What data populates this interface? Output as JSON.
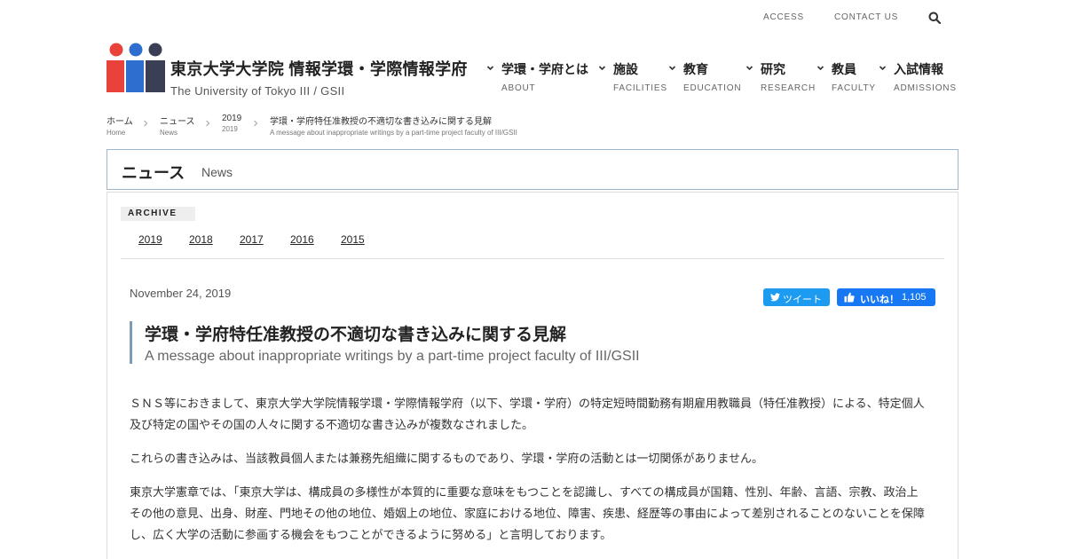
{
  "utility": {
    "access": "ACCESS",
    "contact": "CONTACT US"
  },
  "site": {
    "title_ja": "東京大学大学院 情報学環・学際情報学府",
    "title_en": "The University of Tokyo III / GSII",
    "logo_colors": [
      "#e8423b",
      "#2e6ecf",
      "#3a3f55"
    ]
  },
  "nav": [
    {
      "ja": "学環・学府とは",
      "en": "ABOUT"
    },
    {
      "ja": "施設",
      "en": "FACILITIES"
    },
    {
      "ja": "教育",
      "en": "EDUCATION"
    },
    {
      "ja": "研究",
      "en": "RESEARCH"
    },
    {
      "ja": "教員",
      "en": "FACULTY"
    },
    {
      "ja": "入試情報",
      "en": "ADMISSIONS"
    }
  ],
  "breadcrumb": [
    {
      "ja": "ホーム",
      "en": "Home"
    },
    {
      "ja": "ニュース",
      "en": "News"
    },
    {
      "ja": "2019",
      "en": "2019"
    },
    {
      "ja": "学環・学府特任准教授の不適切な書き込みに関する見解",
      "en": "A message about inappropriate writings by a part-time project faculty of III/GSII"
    }
  ],
  "page_heading": {
    "ja": "ニュース",
    "en": "News"
  },
  "archive": {
    "label": "ARCHIVE",
    "years": [
      "2019",
      "2018",
      "2017",
      "2016",
      "2015"
    ]
  },
  "article": {
    "date": "November 24, 2019",
    "tweet_label": "ツイート",
    "like_label": "いいね！",
    "like_count": "1,105",
    "title_ja": "学環・学府特任准教授の不適切な書き込みに関する見解",
    "title_en": "A message about inappropriate writings by a part-time project faculty of III/GSII",
    "paragraphs": [
      "ＳＮＳ等におきまして、東京大学大学院情報学環・学際情報学府（以下、学環・学府）の特定短時間勤務有期雇用教職員（特任准教授）による、特定個人及び特定の国やその国の人々に関する不適切な書き込みが複数なされました。",
      "これらの書き込みは、当該教員個人または兼務先組織に関するものであり、学環・学府の活動とは一切関係がありません。",
      "東京大学憲章では、「東京大学は、構成員の多様性が本質的に重要な意味をもつことを認識し、すべての構成員が国籍、性別、年齢、言語、宗教、政治上その他の意見、出身、財産、門地その他の地位、婚姻上の地位、家庭における地位、障害、疾患、経歴等の事由によって差別されることのないことを保障し、広く大学の活動に参画する機会をもつことができるように努める」と言明しております。"
    ]
  },
  "colors": {
    "accent_border": "#7d9bb7",
    "head_border": "#9fb7cc",
    "tweet": "#1d9bf0",
    "like": "#1877f2"
  }
}
